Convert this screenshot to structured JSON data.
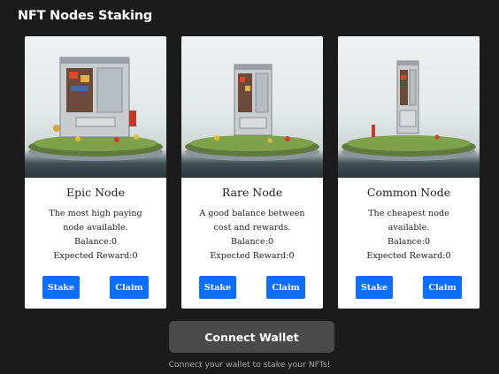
{
  "page": {
    "title": "NFT Nodes Staking"
  },
  "cards": [
    {
      "title": "Epic Node",
      "description": "The most high paying node available.",
      "balance": "Balance:0",
      "reward": "Expected Reward:0",
      "stake_label": "Stake",
      "claim_label": "Claim"
    },
    {
      "title": "Rare Node",
      "description": "A good balance between cost and rewards.",
      "balance": "Balance:0",
      "reward": "Expected Reward:0",
      "stake_label": "Stake",
      "claim_label": "Claim"
    },
    {
      "title": "Common Node",
      "description": "The cheapest node available.",
      "balance": "Balance:0",
      "reward": "Expected Reward:0",
      "stake_label": "Stake",
      "claim_label": "Claim"
    }
  ],
  "footer": {
    "connect_label": "Connect Wallet",
    "hint": "Connect your wallet to stake your NFTs!"
  },
  "colors": {
    "background": "#1b1b1c",
    "button_primary": "#0d6efd",
    "connect_button": "#4a4a4b"
  }
}
